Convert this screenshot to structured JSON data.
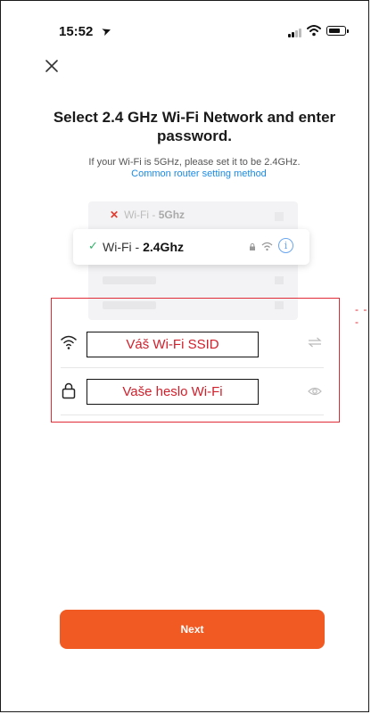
{
  "status_bar": {
    "time": "15:52",
    "icons": [
      "location-arrow-icon",
      "cellular-signal-icon",
      "wifi-icon",
      "battery-icon"
    ]
  },
  "header": {
    "close_icon": "close-icon"
  },
  "title": "Select 2.4 GHz Wi-Fi Network and enter password.",
  "subtitle": "If your Wi-Fi is 5GHz, please set it to be 2.4GHz.",
  "link_text": "Common router setting method",
  "illustration": {
    "bad_network_prefix": "Wi-Fi - ",
    "bad_network_band": "5Ghz",
    "good_network_prefix": "Wi-Fi - ",
    "good_network_band": "2.4Ghz"
  },
  "form": {
    "ssid_annotation": "Váš Wi-Fi SSID",
    "password_annotation": "Vaše heslo Wi-Fi"
  },
  "next_label": "Next",
  "colors": {
    "accent": "#f25a23",
    "link": "#1a8ae5",
    "annotation": "#e02a35",
    "check": "#31b36b"
  }
}
